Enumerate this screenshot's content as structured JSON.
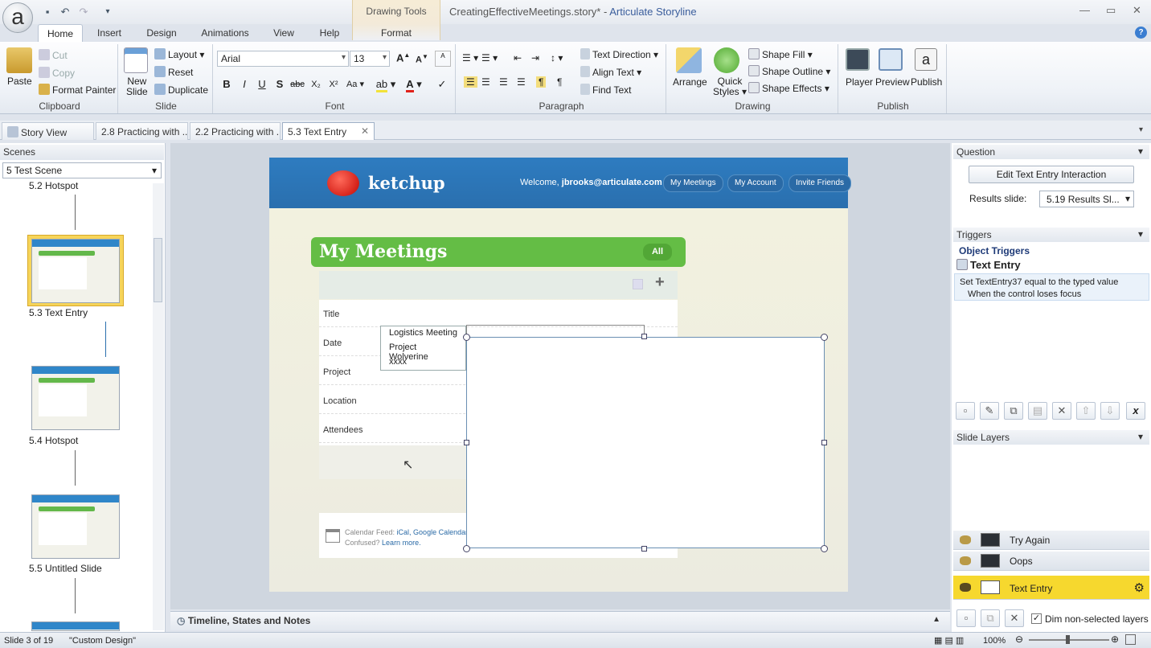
{
  "window": {
    "title_file": "CreatingEffectiveMeetings.story*",
    "title_sep": " - ",
    "title_app": "Articulate Storyline",
    "logo": "a",
    "contextual_tab_group": "Drawing Tools"
  },
  "ribbon_tabs": [
    "Home",
    "Insert",
    "Design",
    "Animations",
    "View",
    "Help",
    "Format"
  ],
  "ribbon": {
    "clipboard": {
      "label": "Clipboard",
      "paste": "Paste",
      "cut": "Cut",
      "copy": "Copy",
      "format_painter": "Format Painter"
    },
    "slide": {
      "label": "Slide",
      "new_slide": "New Slide",
      "new_slide_l1": "New",
      "new_slide_l2": "Slide",
      "layout": "Layout",
      "reset": "Reset",
      "duplicate": "Duplicate"
    },
    "font": {
      "label": "Font",
      "family": "Arial",
      "size": "13"
    },
    "paragraph": {
      "label": "Paragraph",
      "text_direction": "Text Direction",
      "align_text": "Align Text",
      "find_text": "Find Text"
    },
    "drawing": {
      "label": "Drawing",
      "arrange": "Arrange",
      "quick_styles_l1": "Quick",
      "quick_styles_l2": "Styles",
      "shape_fill": "Shape Fill",
      "shape_outline": "Shape Outline",
      "shape_effects": "Shape Effects"
    },
    "publish": {
      "label": "Publish",
      "player": "Player",
      "preview": "Preview",
      "publish": "Publish"
    }
  },
  "doc_tabs": [
    "Story View",
    "2.8 Practicing with ...",
    "2.2 Practicing with ...",
    "5.3 Text Entry"
  ],
  "scenes": {
    "header": "Scenes",
    "selected": "5 Test Scene",
    "slides": [
      "5.2 Hotspot",
      "5.3 Text Entry",
      "5.4 Hotspot",
      "5.5 Untitled Slide"
    ]
  },
  "slide": {
    "brand": "ketchup",
    "welcome_prefix": "Welcome, ",
    "welcome_user": "jbrooks@articulate.com",
    "nav": [
      "My Meetings",
      "My Account",
      "Invite Friends"
    ],
    "section_title": "My Meetings",
    "all_button": "All",
    "fields": [
      "Title",
      "Date",
      "Project",
      "Location",
      "Attendees"
    ],
    "dropdown_items": [
      "Logistics Meeting",
      "Project Wolverine",
      "xxxx"
    ],
    "cal_feed_label": "Calendar Feed: ",
    "cal_feed_links": "iCal, Google Calendar",
    "confused_label": "Confused? ",
    "confused_link": "Learn more."
  },
  "timeline_label": "Timeline, States and Notes",
  "question": {
    "header": "Question",
    "edit_button": "Edit Text Entry Interaction",
    "results_label": "Results slide:",
    "results_value": "5.19 Results Sl..."
  },
  "triggers": {
    "header": "Triggers",
    "group": "Object Triggers",
    "object": "Text Entry",
    "line1": "Set TextEntry37 equal to the typed value",
    "line2": "When the control loses focus"
  },
  "layers": {
    "header": "Slide Layers",
    "items": [
      "Try Again",
      "Oops",
      "Text Entry"
    ],
    "dim_label": "Dim non-selected layers"
  },
  "status": {
    "slide_count": "Slide 3 of 19",
    "design": "\"Custom Design\"",
    "zoom": "100%"
  },
  "colors": {
    "accent_green": "#64bd45",
    "header_blue": "#2e7cc0",
    "layer_highlight": "#f6d82e"
  }
}
